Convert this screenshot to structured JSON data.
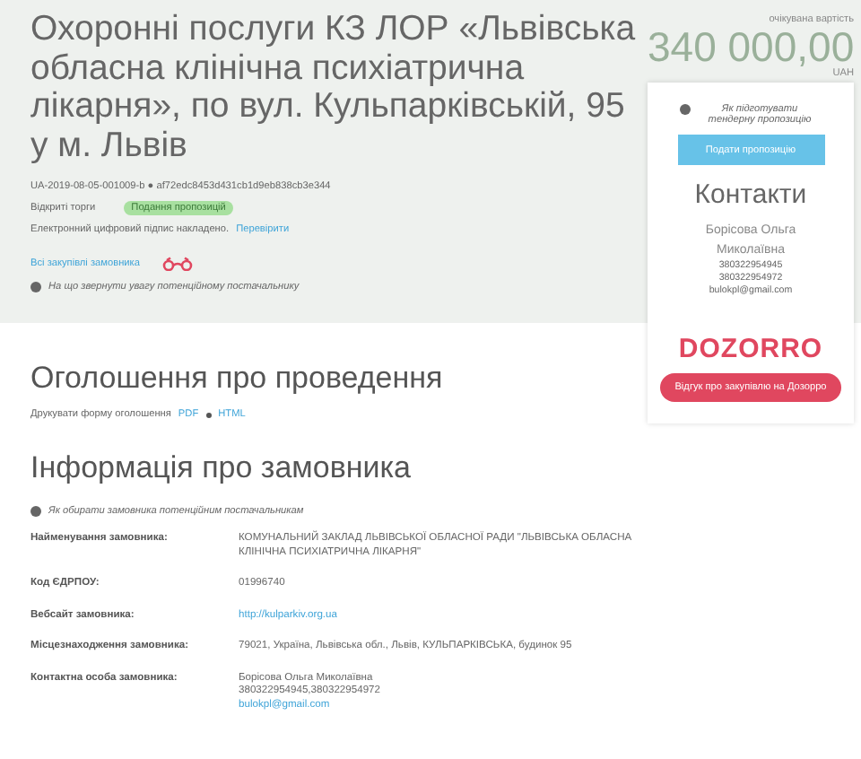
{
  "tender": {
    "title": "Охоронні послуги КЗ ЛОР «Львівська обласна клінічна психіатрична лікарня», по вул. Кульпарківській, 95 у м. Львів",
    "tender_id": "UA-2019-08-05-001009-b ● af72edc8453d431cb1d9eb838cb3e344",
    "procedure": "Відкриті торги",
    "status": "Подання пропозицій",
    "signature_text": "Електронний цифровий підпис накладено.",
    "signature_link": "Перевірити",
    "purchases_link": "Всі закупівлі замовника",
    "notice": "На що звернути увагу потенційному постачальнику"
  },
  "price": {
    "label": "очікувана вартість",
    "amount": "340 000,00",
    "currency": "UAH"
  },
  "card": {
    "help": "Як підготувати тендерну пропозицію",
    "submit_button": "Подати пропозицію",
    "contacts_title": "Контакти",
    "contact_name": "Борісова Ольга Миколаївна",
    "contact_lines": [
      "380322954945",
      "380322954972",
      "bulokpl@gmail.com"
    ],
    "logo": "DOZORRO",
    "dozorro_button": "Відгук про закупівлю на Дозорро"
  },
  "announcement": {
    "heading": "Оголошення про проведення",
    "print_text": "Друкувати форму оголошення",
    "links": [
      "PDF",
      "HTML"
    ]
  },
  "customer": {
    "heading": "Інформація про замовника",
    "help": "Як обирати замовника потенційним постачальникам",
    "rows": [
      {
        "label": "Найменування замовника:",
        "lines": [
          {
            "text": "КОМУНАЛЬНИЙ ЗАКЛАД ЛЬВІВСЬКОЇ ОБЛАСНОЇ РАДИ \"ЛЬВІВСЬКА ОБЛАСНА КЛІНІЧНА ПСИХІАТРИЧНА ЛІКАРНЯ\"",
            "kind": "text"
          }
        ]
      },
      {
        "label": "Код ЄДРПОУ:",
        "lines": [
          {
            "text": "01996740",
            "kind": "text"
          }
        ]
      },
      {
        "label": "Вебсайт замовника:",
        "lines": [
          {
            "text": "http://kulparkiv.org.ua",
            "kind": "link"
          }
        ]
      },
      {
        "label": "Місцезнаходження замовника:",
        "lines": [
          {
            "text": "79021, Україна, Львівська обл., Львів, КУЛЬПАРКІВСЬКА, будинок 95",
            "kind": "text"
          }
        ]
      },
      {
        "label": "Контактна особа замовника:",
        "lines": [
          {
            "text": "Борісова Ольга Миколаївна",
            "kind": "text"
          },
          {
            "text": "380322954945,380322954972",
            "kind": "text"
          },
          {
            "text": "bulokpl@gmail.com",
            "kind": "link"
          }
        ]
      }
    ]
  }
}
